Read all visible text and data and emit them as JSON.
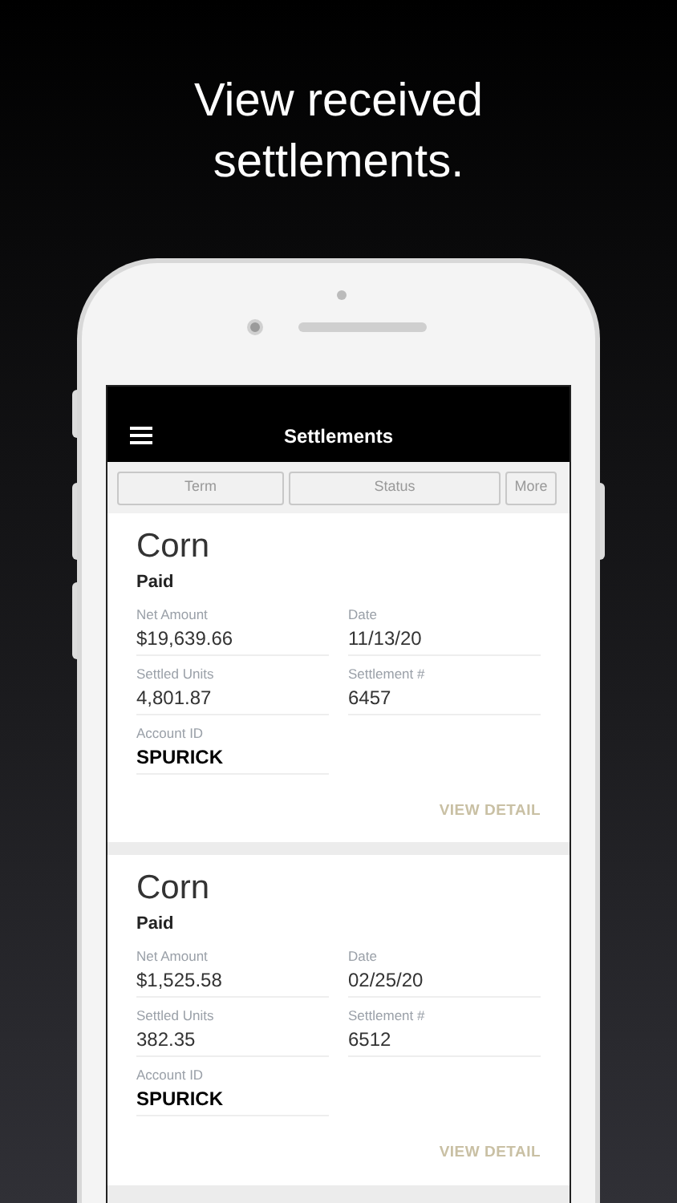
{
  "headline": "View received settlements.",
  "app_bar": {
    "title": "Settlements"
  },
  "filters": [
    {
      "label": "Term"
    },
    {
      "label": "Status"
    },
    {
      "label": "More"
    }
  ],
  "settlements": [
    {
      "title": "Corn",
      "status": "Paid",
      "fields": [
        {
          "label": "Net Amount",
          "value": "$19,639.66",
          "emphasis": false
        },
        {
          "label": "Date",
          "value": "11/13/20",
          "emphasis": false
        },
        {
          "label": "Settled Units",
          "value": "4,801.87",
          "emphasis": false
        },
        {
          "label": "Settlement #",
          "value": "6457",
          "emphasis": false
        },
        {
          "label": "Account ID",
          "value": "SPURICK",
          "emphasis": true
        }
      ],
      "action": "VIEW DETAIL"
    },
    {
      "title": "Corn",
      "status": "Paid",
      "fields": [
        {
          "label": "Net Amount",
          "value": "$1,525.58",
          "emphasis": false
        },
        {
          "label": "Date",
          "value": "02/25/20",
          "emphasis": false
        },
        {
          "label": "Settled Units",
          "value": "382.35",
          "emphasis": false
        },
        {
          "label": "Settlement #",
          "value": "6512",
          "emphasis": false
        },
        {
          "label": "Account ID",
          "value": "SPURICK",
          "emphasis": true
        }
      ],
      "action": "VIEW DETAIL"
    }
  ]
}
